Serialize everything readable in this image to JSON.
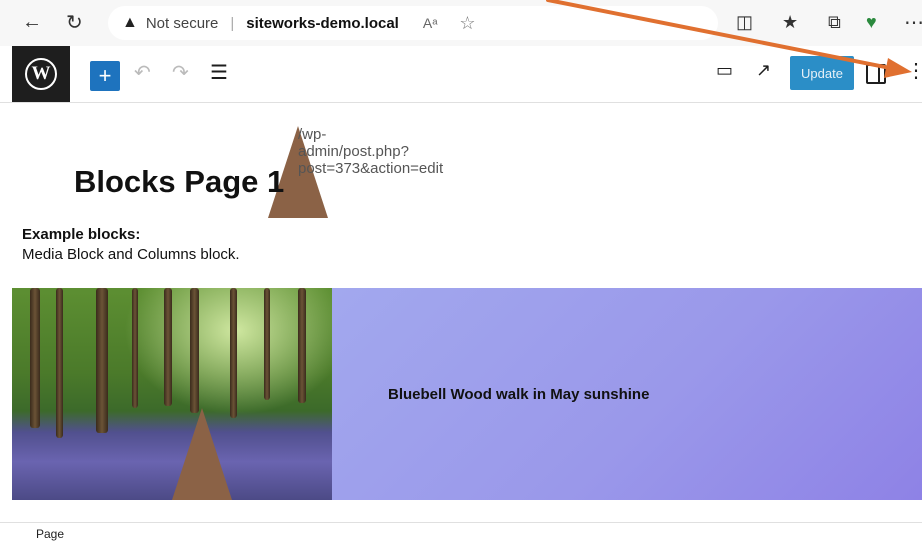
{
  "browser": {
    "security_label": "Not secure",
    "url_host": "siteworks-demo.local",
    "url_path": "/wp-admin/post.php?post=373&action=edit",
    "read_aloud": "Aᵃ",
    "icons": [
      "back-icon",
      "refresh-icon",
      "warning-icon",
      "star-icon",
      "split-screen-icon",
      "favorites-icon",
      "collections-icon",
      "health-icon",
      "more-icon"
    ]
  },
  "editor": {
    "logo": "W",
    "toolbar": {
      "add_block": "+",
      "update_label": "Update"
    }
  },
  "content": {
    "title": "Blocks Page 1",
    "intro_bold": "Example blocks:",
    "intro_text": "Media Block and Columns block.",
    "media_caption": "Bluebell Wood walk in May sunshine"
  },
  "footer": {
    "breadcrumb": "Page"
  },
  "colors": {
    "accent": "#2b8ec7",
    "annotation": "#e07030"
  }
}
